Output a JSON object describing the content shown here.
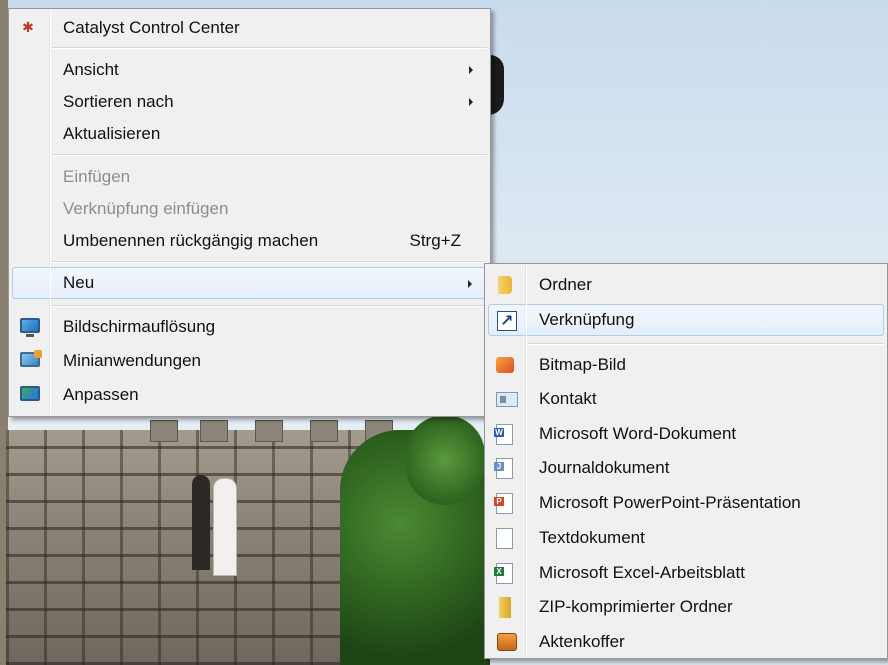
{
  "context_menu": {
    "items": [
      {
        "label": "Catalyst Control Center",
        "icon": "catalyst-icon"
      },
      {
        "label": "Ansicht",
        "submenu": true
      },
      {
        "label": "Sortieren nach",
        "submenu": true
      },
      {
        "label": "Aktualisieren"
      },
      {
        "label": "Einfügen",
        "disabled": true
      },
      {
        "label": "Verknüpfung einfügen",
        "disabled": true
      },
      {
        "label": "Umbenennen rückgängig machen",
        "shortcut": "Strg+Z"
      },
      {
        "label": "Neu",
        "submenu": true,
        "highlighted": true
      },
      {
        "label": "Bildschirmauflösung",
        "icon": "display-icon"
      },
      {
        "label": "Minianwendungen",
        "icon": "gadgets-icon"
      },
      {
        "label": "Anpassen",
        "icon": "personalize-icon"
      }
    ]
  },
  "new_submenu": {
    "items": [
      {
        "label": "Ordner",
        "icon": "folder-icon"
      },
      {
        "label": "Verknüpfung",
        "icon": "shortcut-icon",
        "highlighted": true
      },
      {
        "label": "Bitmap-Bild",
        "icon": "bitmap-icon"
      },
      {
        "label": "Kontakt",
        "icon": "contact-icon"
      },
      {
        "label": "Microsoft Word-Dokument",
        "icon": "word-document-icon"
      },
      {
        "label": "Journaldokument",
        "icon": "journal-document-icon"
      },
      {
        "label": "Microsoft PowerPoint-Präsentation",
        "icon": "powerpoint-icon"
      },
      {
        "label": "Textdokument",
        "icon": "text-document-icon"
      },
      {
        "label": "Microsoft Excel-Arbeitsblatt",
        "icon": "excel-icon"
      },
      {
        "label": "ZIP-komprimierter Ordner",
        "icon": "zip-folder-icon"
      },
      {
        "label": "Aktenkoffer",
        "icon": "briefcase-icon"
      }
    ]
  }
}
